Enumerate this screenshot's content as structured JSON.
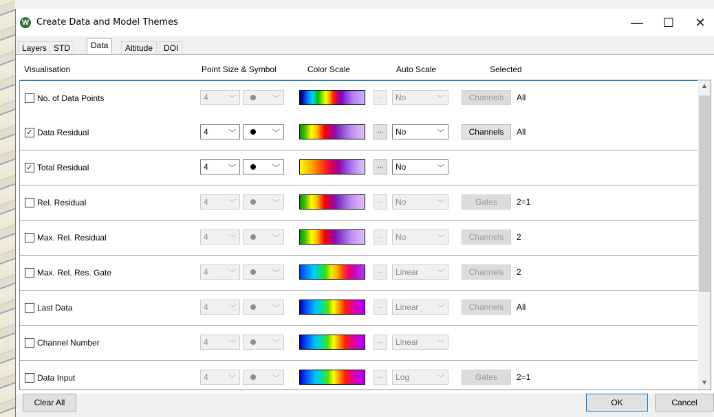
{
  "window": {
    "title": "Create Data and Model Themes",
    "icon_letter": "W",
    "controls": {
      "minimize": "—",
      "maximize": "☐",
      "close": "✕"
    }
  },
  "tabs": [
    {
      "label": "Layers",
      "active": false
    },
    {
      "label": "STD",
      "active": false
    },
    {
      "label": "Data",
      "active": true
    },
    {
      "label": "Altitude",
      "active": false
    },
    {
      "label": "DOI",
      "active": false
    }
  ],
  "columns": {
    "visualisation": "Visualisation",
    "point_size_symbol": "Point Size & Symbol",
    "color_scale": "Color Scale",
    "auto_scale": "Auto Scale",
    "selected": "Selected"
  },
  "rows": [
    {
      "label": "No. of Data Points",
      "checked": false,
      "size": "4",
      "auto": "No",
      "button": "Channels",
      "selected": "All"
    },
    {
      "label": "Data Residual",
      "checked": true,
      "size": "4",
      "auto": "No",
      "button": "Channels",
      "selected": "All"
    },
    {
      "label": "Total Residual",
      "checked": true,
      "size": "4",
      "auto": "No",
      "button": "",
      "selected": ""
    },
    {
      "label": "Rel. Residual",
      "checked": false,
      "size": "4",
      "auto": "No",
      "button": "Gates",
      "selected": "2=1"
    },
    {
      "label": "Max. Rel. Residual",
      "checked": false,
      "size": "4",
      "auto": "No",
      "button": "Channels",
      "selected": "2"
    },
    {
      "label": "Max. Rel. Res. Gate",
      "checked": false,
      "size": "4",
      "auto": "Linear",
      "button": "Channels",
      "selected": "2"
    },
    {
      "label": "Last Data",
      "checked": false,
      "size": "4",
      "auto": "Linear",
      "button": "Channels",
      "selected": "All"
    },
    {
      "label": "Channel Number",
      "checked": false,
      "size": "4",
      "auto": "Linear",
      "button": "",
      "selected": ""
    },
    {
      "label": "Data Input",
      "checked": false,
      "size": "4",
      "auto": "Log",
      "button": "Gates",
      "selected": "2=1"
    }
  ],
  "glyphs": {
    "ellipsis": "...",
    "dropdown": "﹀",
    "check": "✓",
    "scroll_up": "▲",
    "scroll_down": "▼"
  },
  "footer": {
    "clear_all": "Clear All",
    "ok": "OK",
    "cancel": "Cancel"
  },
  "colors": {
    "accent_border": "#0078d7",
    "disabled_text": "#8a8a8a"
  },
  "scrollbar": {
    "position_fraction": 0.0
  }
}
